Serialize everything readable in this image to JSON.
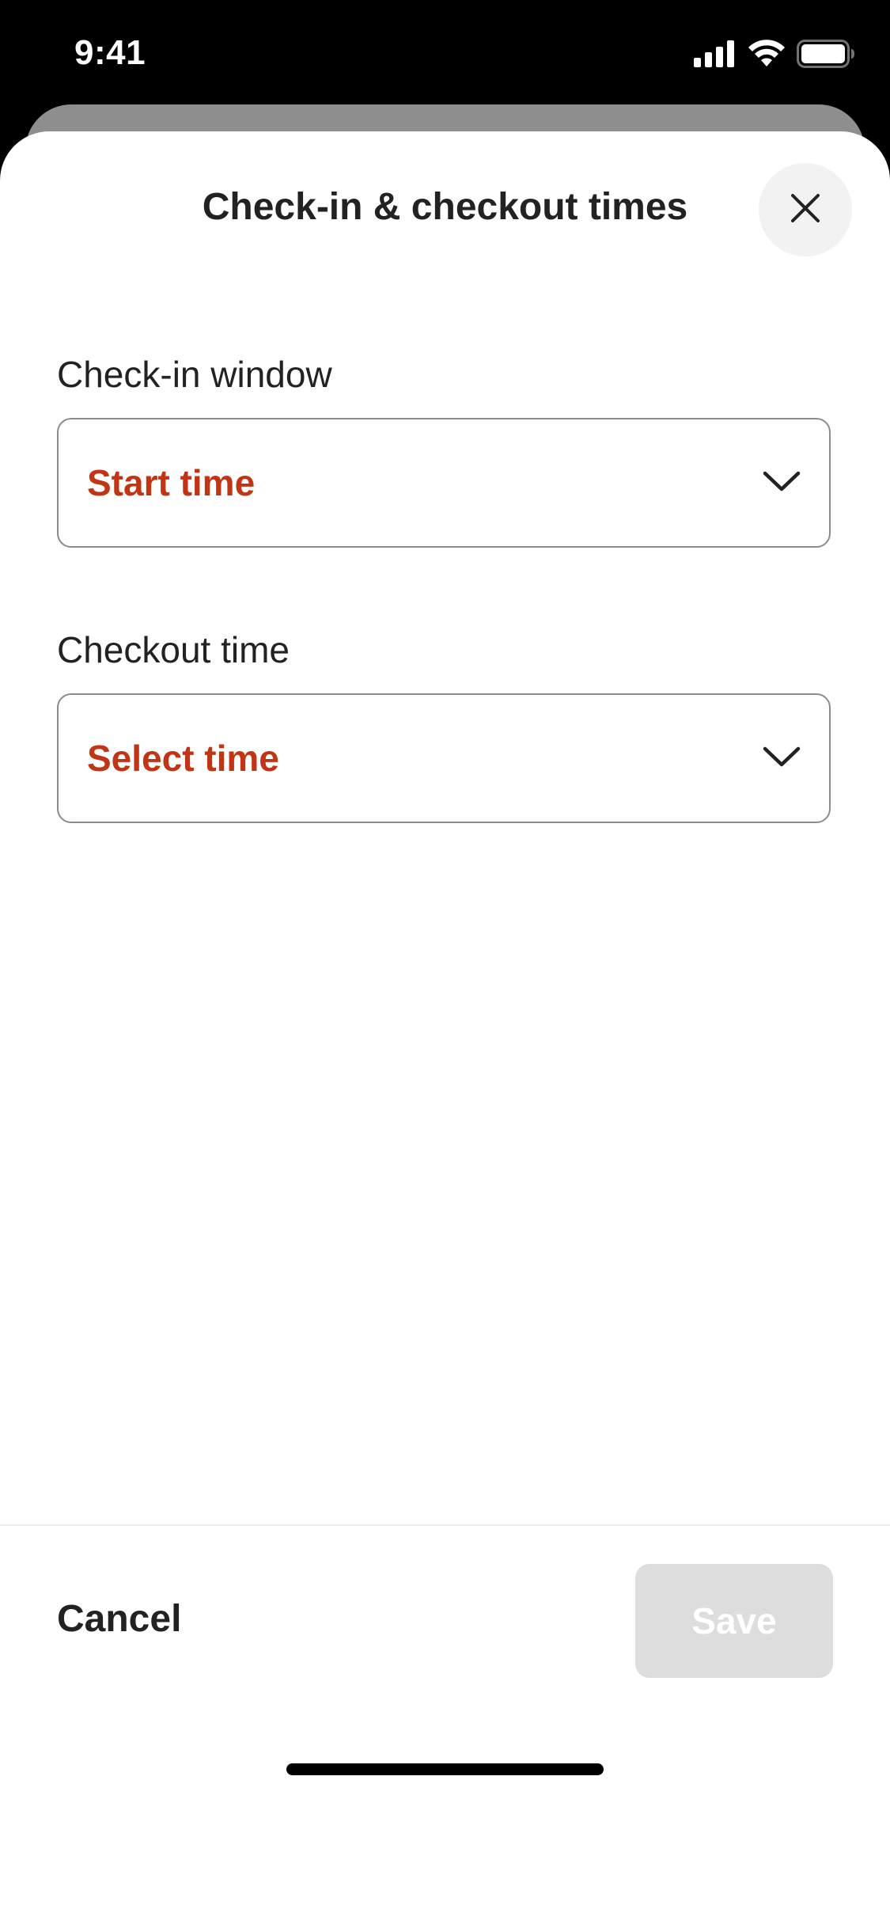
{
  "status_bar": {
    "time": "9:41"
  },
  "sheet": {
    "title": "Check-in & checkout times"
  },
  "fields": {
    "checkin": {
      "label": "Check-in window",
      "value": "Start time"
    },
    "checkout": {
      "label": "Checkout time",
      "value": "Select time"
    }
  },
  "footer": {
    "cancel_label": "Cancel",
    "save_label": "Save"
  },
  "colors": {
    "accent": "#c13515",
    "save_disabled": "#dddddd"
  },
  "icons": {
    "close": "close-icon",
    "chevron": "chevron-down-icon",
    "signal": "cellular-signal-icon",
    "wifi": "wifi-icon",
    "battery": "battery-icon"
  }
}
